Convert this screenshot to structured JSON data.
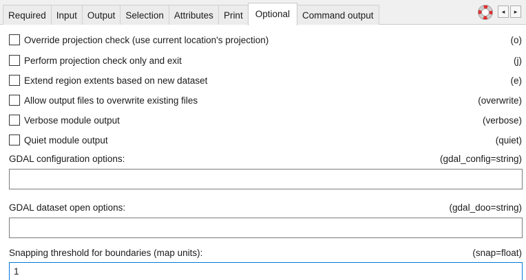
{
  "tabs": [
    {
      "label": "Required"
    },
    {
      "label": "Input"
    },
    {
      "label": "Output"
    },
    {
      "label": "Selection"
    },
    {
      "label": "Attributes"
    },
    {
      "label": "Print"
    },
    {
      "label": "Optional",
      "active": true
    },
    {
      "label": "Command output"
    }
  ],
  "tab_scroll": {
    "left": "◂",
    "right": "▸"
  },
  "options": [
    {
      "label": "Override projection check (use current location's projection)",
      "flag": "(o)",
      "checked": false
    },
    {
      "label": "Perform projection check only and exit",
      "flag": "(j)",
      "checked": false
    },
    {
      "label": "Extend region extents based on new dataset",
      "flag": "(e)",
      "checked": false
    },
    {
      "label": "Allow output files to overwrite existing files",
      "flag": "(overwrite)",
      "checked": false
    },
    {
      "label": "Verbose module output",
      "flag": "(verbose)",
      "checked": false
    },
    {
      "label": "Quiet module output",
      "flag": "(quiet)",
      "checked": false
    }
  ],
  "fields": [
    {
      "label": "GDAL configuration options:",
      "flag": "(gdal_config=string)",
      "value": ""
    },
    {
      "label": "GDAL dataset open options:",
      "flag": "(gdal_doo=string)",
      "value": ""
    },
    {
      "label": "Snapping threshold for boundaries (map units):",
      "flag": "(snap=float)",
      "value": "1"
    }
  ],
  "colors": {
    "accent_focus": "#0078d7",
    "tabbar_bg": "#f0f0f0",
    "help_icon_red": "#e03030"
  }
}
